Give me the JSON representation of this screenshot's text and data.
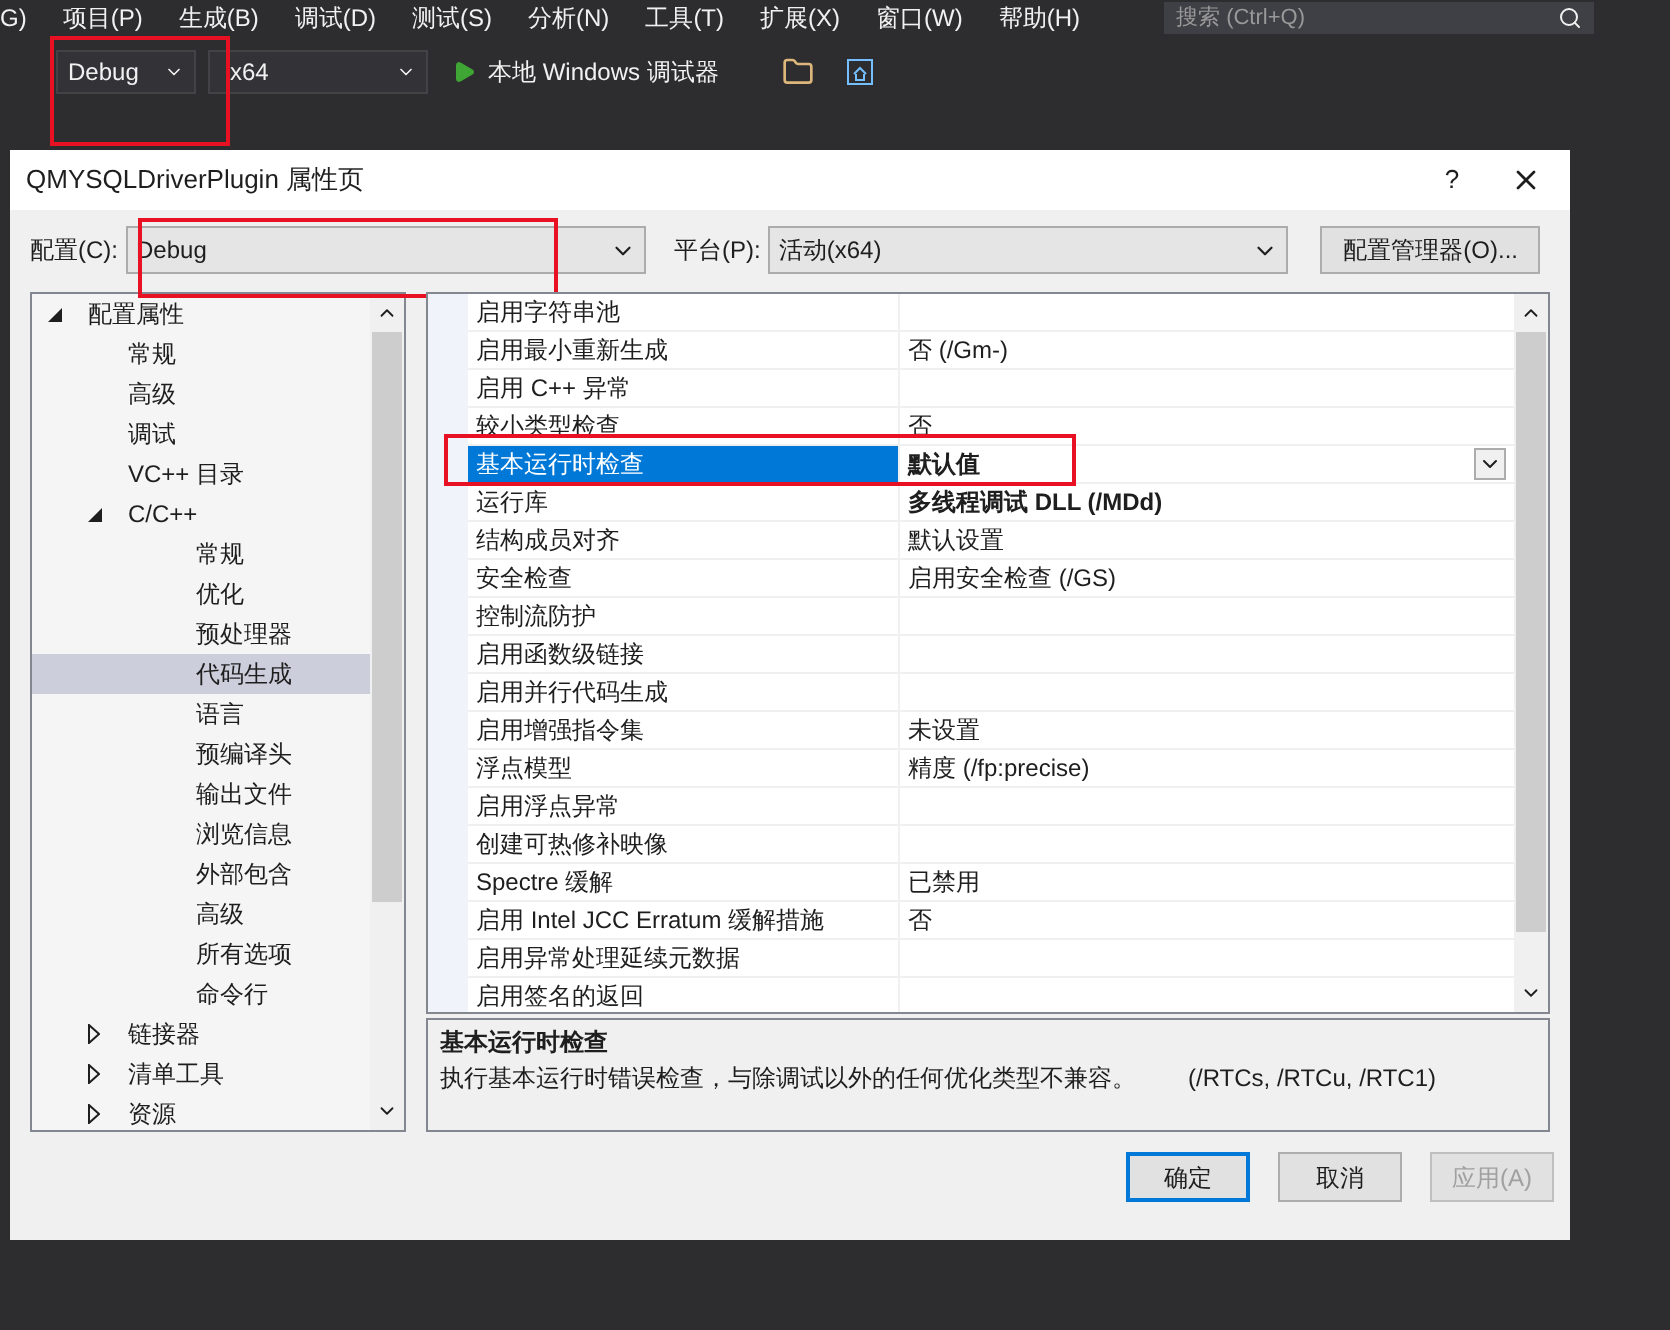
{
  "menu_bar": [
    "G)",
    "项目(P)",
    "生成(B)",
    "调试(D)",
    "测试(S)",
    "分析(N)",
    "工具(T)",
    "扩展(X)",
    "窗口(W)",
    "帮助(H)"
  ],
  "search": {
    "placeholder": "搜索 (Ctrl+Q)"
  },
  "toolbar": {
    "configuration": "Debug",
    "platform": "x64",
    "run_label": "本地 Windows 调试器"
  },
  "dialog": {
    "title": "QMYSQLDriverPlugin 属性页",
    "help": "?",
    "config_label": "配置(C):",
    "config_value": "Debug",
    "platform_label": "平台(P):",
    "platform_value": "活动(x64)",
    "manager_button": "配置管理器(O)...",
    "tree": [
      {
        "label": "配置属性",
        "expanded": true,
        "selected": false,
        "children": [
          {
            "label": "常规",
            "selected": false
          },
          {
            "label": "高级",
            "selected": false
          },
          {
            "label": "调试",
            "selected": false
          },
          {
            "label": "VC++ 目录",
            "selected": false
          },
          {
            "label": "C/C++",
            "expanded": true,
            "selected": false,
            "children": [
              {
                "label": "常规",
                "selected": false
              },
              {
                "label": "优化",
                "selected": false
              },
              {
                "label": "预处理器",
                "selected": false
              },
              {
                "label": "代码生成",
                "selected": true
              },
              {
                "label": "语言",
                "selected": false
              },
              {
                "label": "预编译头",
                "selected": false
              },
              {
                "label": "输出文件",
                "selected": false
              },
              {
                "label": "浏览信息",
                "selected": false
              },
              {
                "label": "外部包含",
                "selected": false
              },
              {
                "label": "高级",
                "selected": false
              },
              {
                "label": "所有选项",
                "selected": false
              },
              {
                "label": "命令行",
                "selected": false
              }
            ]
          },
          {
            "label": "链接器",
            "expanded": false,
            "selected": false
          },
          {
            "label": "清单工具",
            "expanded": false,
            "selected": false
          },
          {
            "label": "资源",
            "expanded": false,
            "selected": false
          }
        ]
      }
    ],
    "properties": [
      {
        "name": "启用字符串池",
        "selected": false
      },
      {
        "name": "启用最小重新生成",
        "value": "否 (/Gm-)",
        "bold": false,
        "selected": false
      },
      {
        "name": "启用 C++ 异常",
        "selected": false
      },
      {
        "name": "较小类型检查",
        "value": "否",
        "bold": false,
        "selected": false
      },
      {
        "name": "基本运行时检查",
        "value": "默认值",
        "bold": true,
        "selected": true
      },
      {
        "name": "运行库",
        "value": "多线程调试 DLL (/MDd)",
        "bold": true,
        "selected": false
      },
      {
        "name": "结构成员对齐",
        "value": "默认设置",
        "bold": false,
        "selected": false
      },
      {
        "name": "安全检查",
        "value": "启用安全检查 (/GS)",
        "bold": false,
        "selected": false
      },
      {
        "name": "控制流防护",
        "selected": false
      },
      {
        "name": "启用函数级链接",
        "selected": false
      },
      {
        "name": "启用并行代码生成",
        "selected": false
      },
      {
        "name": "启用增强指令集",
        "value": "未设置",
        "bold": false,
        "selected": false
      },
      {
        "name": "浮点模型",
        "value": "精度 (/fp:precise)",
        "bold": false,
        "selected": false
      },
      {
        "name": "启用浮点异常",
        "selected": false
      },
      {
        "name": "创建可热修补映像",
        "selected": false
      },
      {
        "name": "Spectre 缓解",
        "value": "已禁用",
        "bold": false,
        "selected": false
      },
      {
        "name": "启用 Intel JCC Erratum 缓解措施",
        "value": "否",
        "bold": false,
        "selected": false
      },
      {
        "name": "启用异常处理延续元数据",
        "selected": false
      },
      {
        "name": "启用签名的返回",
        "selected": false
      }
    ],
    "description": {
      "title": "基本运行时检查",
      "text": "执行基本运行时错误检查，与除调试以外的任何优化类型不兼容。",
      "switches": "(/RTCs, /RTCu, /RTC1)"
    },
    "buttons": [
      {
        "label": "确定",
        "kind": "default",
        "disabled": false
      },
      {
        "label": "取消",
        "kind": "normal",
        "disabled": false
      },
      {
        "label": "应用(A)",
        "kind": "normal",
        "disabled": true
      }
    ]
  }
}
